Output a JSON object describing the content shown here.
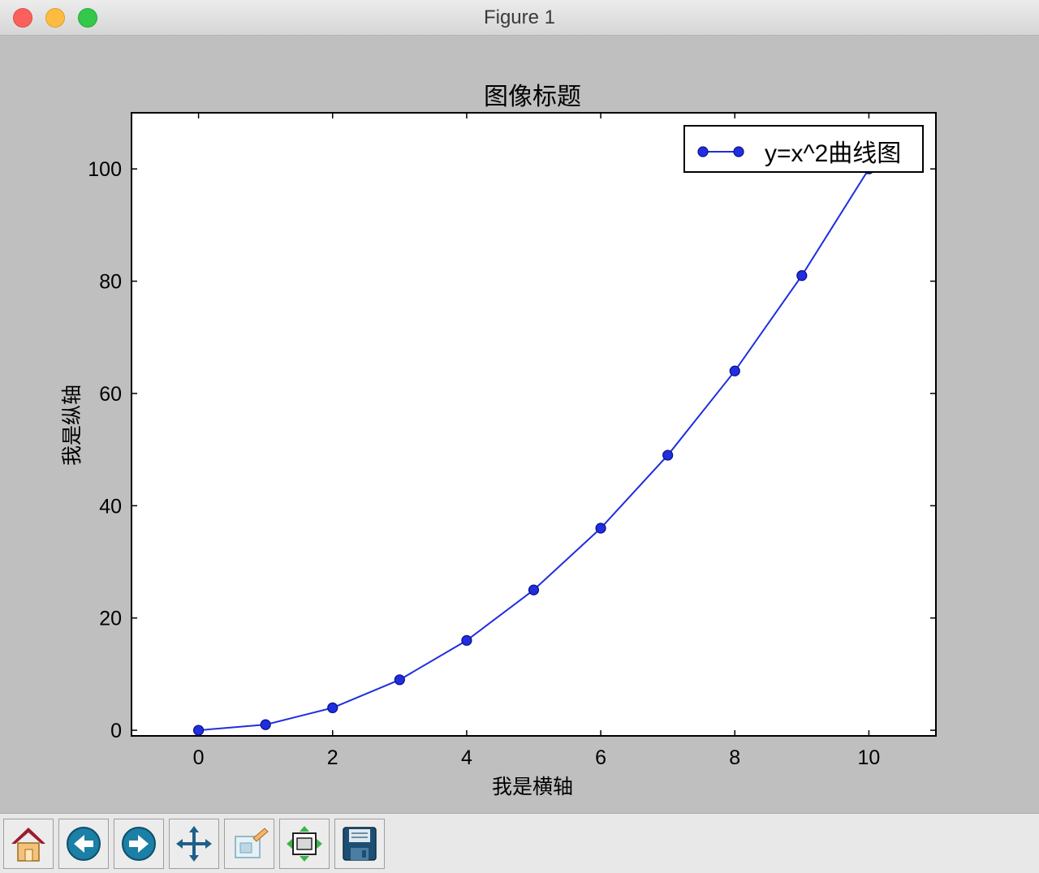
{
  "window": {
    "title": "Figure 1"
  },
  "toolbar": {
    "buttons": [
      {
        "icon": "home-icon",
        "label": "home"
      },
      {
        "icon": "back-arrow-icon",
        "label": "back"
      },
      {
        "icon": "forward-arrow-icon",
        "label": "forward"
      },
      {
        "icon": "pan-move-icon",
        "label": "pan"
      },
      {
        "icon": "zoom-rect-icon",
        "label": "zoom"
      },
      {
        "icon": "subplots-configure-icon",
        "label": "configure subplots"
      },
      {
        "icon": "save-disk-icon",
        "label": "save"
      }
    ]
  },
  "chart_data": {
    "type": "line",
    "title": "图像标题",
    "xlabel": "我是横轴",
    "ylabel": "我是纵轴",
    "xlim": [
      -1,
      11
    ],
    "ylim": [
      -1,
      110
    ],
    "xticks": [
      0,
      2,
      4,
      6,
      8,
      10
    ],
    "yticks": [
      0,
      20,
      40,
      60,
      80,
      100
    ],
    "grid": false,
    "legend": "upper right",
    "colors": {
      "line": "#1f2ee0",
      "marker": "#1f2ee0",
      "marker_edge": "#0a0f80"
    },
    "series": [
      {
        "name": "y=x^2曲线图",
        "x": [
          0,
          1,
          2,
          3,
          4,
          5,
          6,
          7,
          8,
          9,
          10
        ],
        "y": [
          0,
          1,
          4,
          9,
          16,
          25,
          36,
          49,
          64,
          81,
          100
        ],
        "marker": "o"
      }
    ]
  }
}
